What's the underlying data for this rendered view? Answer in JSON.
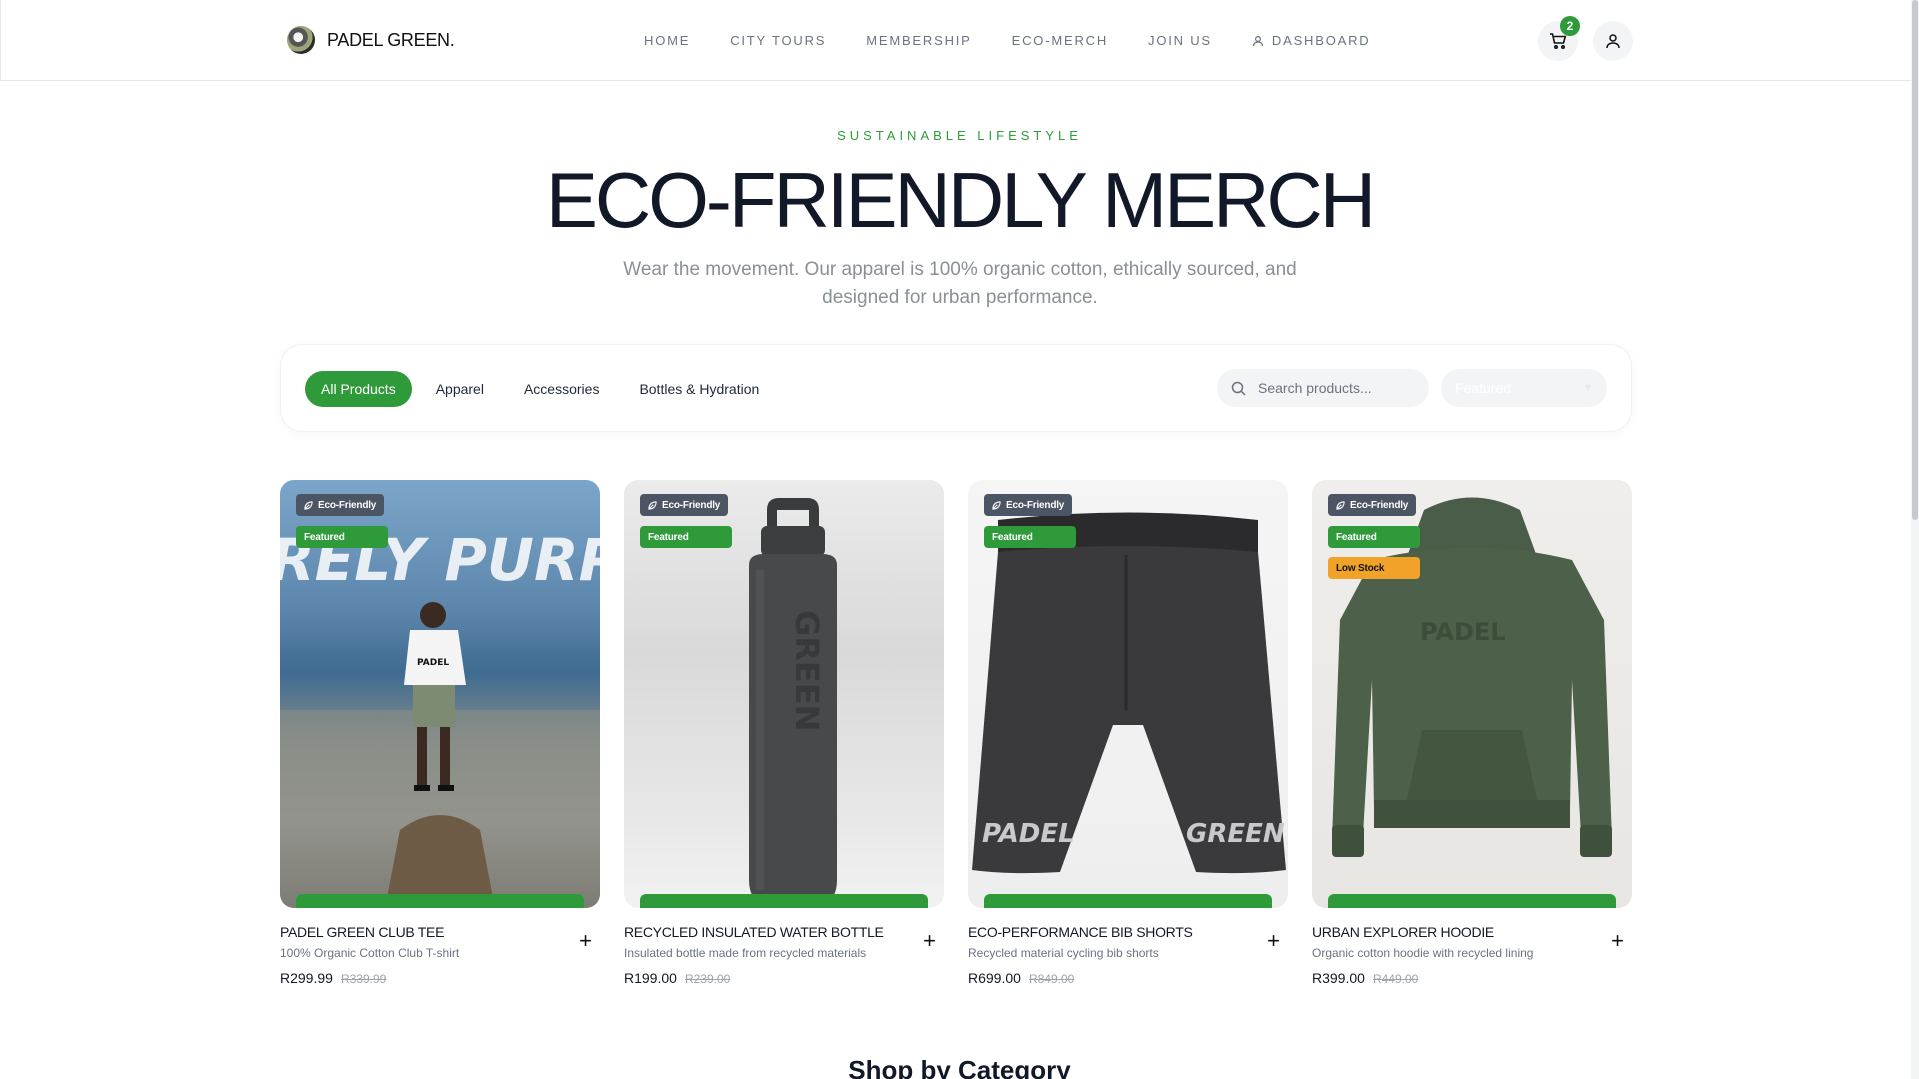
{
  "brand": {
    "name": "PADEL GREEN."
  },
  "nav": [
    "HOME",
    "CITY TOURS",
    "MEMBERSHIP",
    "ECO-MERCH",
    "JOIN US",
    "DASHBOARD"
  ],
  "cart_count": "2",
  "hero": {
    "eyebrow": "SUSTAINABLE LIFESTYLE",
    "title": "ECO-FRIENDLY MERCH",
    "subtitle": "Wear the movement. Our apparel is 100% organic cotton, ethically sourced, and designed for urban performance."
  },
  "filters": {
    "categories": [
      "All Products",
      "Apparel",
      "Accessories",
      "Bottles & Hydration"
    ],
    "active_category": "All Products",
    "search_placeholder": "Search products...",
    "sort_value": "Featured"
  },
  "products": [
    {
      "name": "PADEL GREEN CLUB TEE",
      "desc": "100% Organic Cotton Club T-shirt",
      "price": "R299.99",
      "old_price": "R339.99",
      "tags": [
        "Eco-Friendly",
        "Featured"
      ],
      "image_text": "PADEL"
    },
    {
      "name": "RECYCLED INSULATED WATER BOTTLE",
      "desc": "Insulated bottle made from recycled materials",
      "price": "R199.00",
      "old_price": "R239.00",
      "tags": [
        "Eco-Friendly",
        "Featured"
      ],
      "image_text": "GREEN"
    },
    {
      "name": "ECO-PERFORMANCE BIB SHORTS",
      "desc": "Recycled material cycling bib shorts",
      "price": "R699.00",
      "old_price": "R849.00",
      "tags": [
        "Eco-Friendly",
        "Featured"
      ],
      "image_text_left": "PADEL",
      "image_text_right": "GREEN"
    },
    {
      "name": "URBAN EXPLORER HOODIE",
      "desc": "Organic cotton hoodie with recycled lining",
      "price": "R399.00",
      "old_price": "R449.00",
      "tags": [
        "Eco-Friendly",
        "Featured",
        "Low Stock"
      ],
      "image_text": "PADEL"
    }
  ],
  "section_heading": "Shop by Category",
  "colors": {
    "accent": "#2f9a3a",
    "warning": "#f0a229",
    "text": "#111827",
    "muted": "#6b7280"
  }
}
